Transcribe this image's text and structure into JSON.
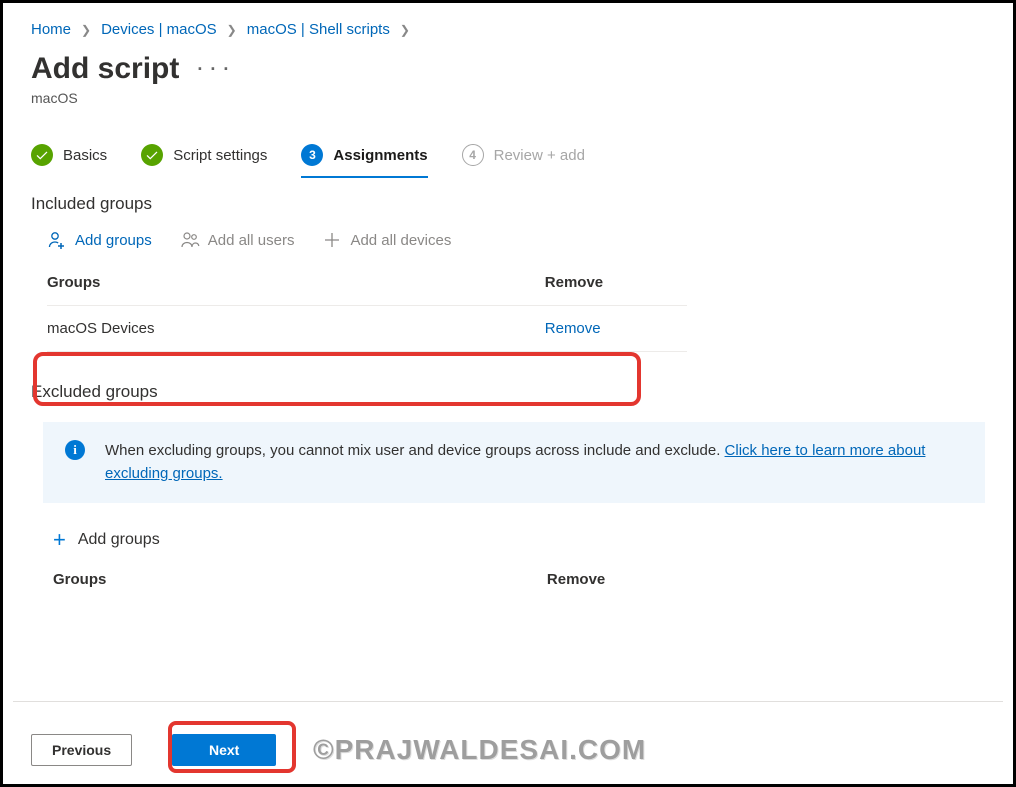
{
  "breadcrumb": {
    "home": "Home",
    "devices": "Devices | macOS",
    "shell": "macOS | Shell scripts"
  },
  "header": {
    "title": "Add script",
    "subtitle": "macOS"
  },
  "steps": {
    "basics": "Basics",
    "script_settings": "Script settings",
    "assignments_num": "3",
    "assignments": "Assignments",
    "review_num": "4",
    "review": "Review + add"
  },
  "included": {
    "heading": "Included groups",
    "add_groups": "Add groups",
    "add_all_users": "Add all users",
    "add_all_devices": "Add all devices",
    "col_groups": "Groups",
    "col_remove": "Remove",
    "row_name": "macOS Devices",
    "row_action": "Remove"
  },
  "excluded": {
    "heading": "Excluded groups",
    "info_text": "When excluding groups, you cannot mix user and device groups across include and exclude. ",
    "info_link": "Click here to learn more about excluding groups.",
    "add_groups": "Add groups",
    "col_groups": "Groups",
    "col_remove": "Remove"
  },
  "footer": {
    "previous": "Previous",
    "next": "Next"
  },
  "watermark": "©PRAJWALDESAI.COM"
}
